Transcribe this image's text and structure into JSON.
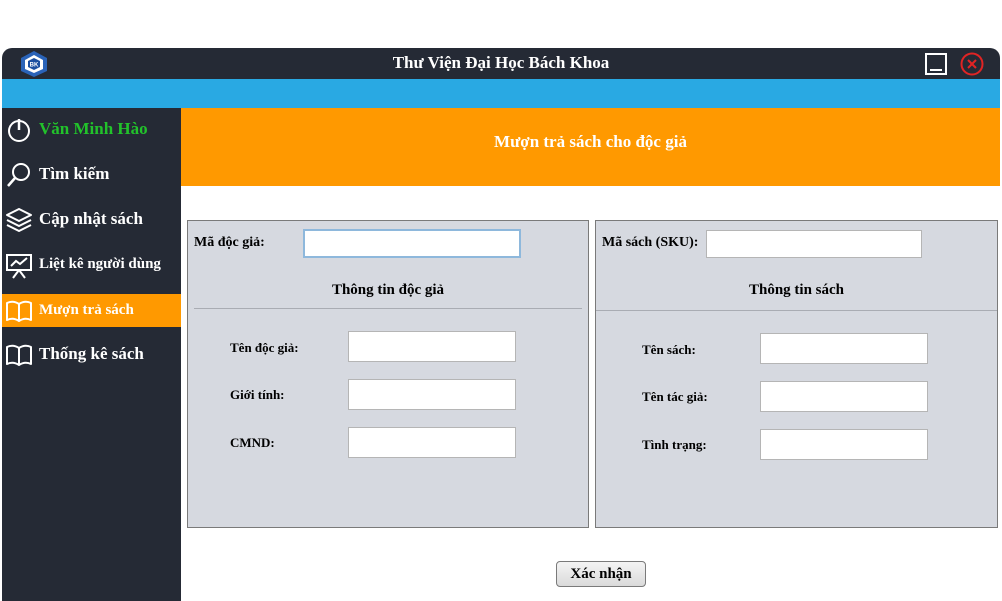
{
  "window": {
    "title": "Thư Viện Đại Học Bách Khoa",
    "logo_text": "BK",
    "icons": {
      "minimize": "minimize-icon",
      "close": "close-circle-icon"
    },
    "colors": {
      "titlebar": "#252a35",
      "accent_bar": "#29a9e3",
      "close": "#e02424"
    }
  },
  "sidebar": {
    "colors": {
      "background": "#252a35",
      "active": "#ff9900",
      "user_name": "#22c22b"
    },
    "items": [
      {
        "label": "Văn Minh Hào",
        "icon": "power-icon"
      },
      {
        "label": "Tìm kiếm",
        "icon": "search-icon"
      },
      {
        "label": "Cập nhật sách",
        "icon": "layers-icon"
      },
      {
        "label": "Liệt kê người dùng",
        "icon": "presentation-chart-icon"
      },
      {
        "label": "Mượn trả sách",
        "icon": "book-icon",
        "active": true
      },
      {
        "label": "Thống kê sách",
        "icon": "book-icon"
      }
    ]
  },
  "header": {
    "title": "Mượn trả sách cho độc giả",
    "color": "#ff9900"
  },
  "reader_panel": {
    "id_label": "Mã độc giả:",
    "id_value": "",
    "section_title": "Thông tin độc giả",
    "fields": [
      {
        "label": "Tên độc giả:",
        "value": ""
      },
      {
        "label": "Giới tính:",
        "value": ""
      },
      {
        "label": "CMND:",
        "value": ""
      }
    ]
  },
  "book_panel": {
    "sku_label": "Mã sách (SKU):",
    "sku_value": "",
    "section_title": "Thông tin sách",
    "fields": [
      {
        "label": "Tên sách:",
        "value": ""
      },
      {
        "label": "Tên tác giả:",
        "value": ""
      },
      {
        "label": "Tình trạng:",
        "value": ""
      }
    ]
  },
  "confirm_label": "Xác nhận"
}
